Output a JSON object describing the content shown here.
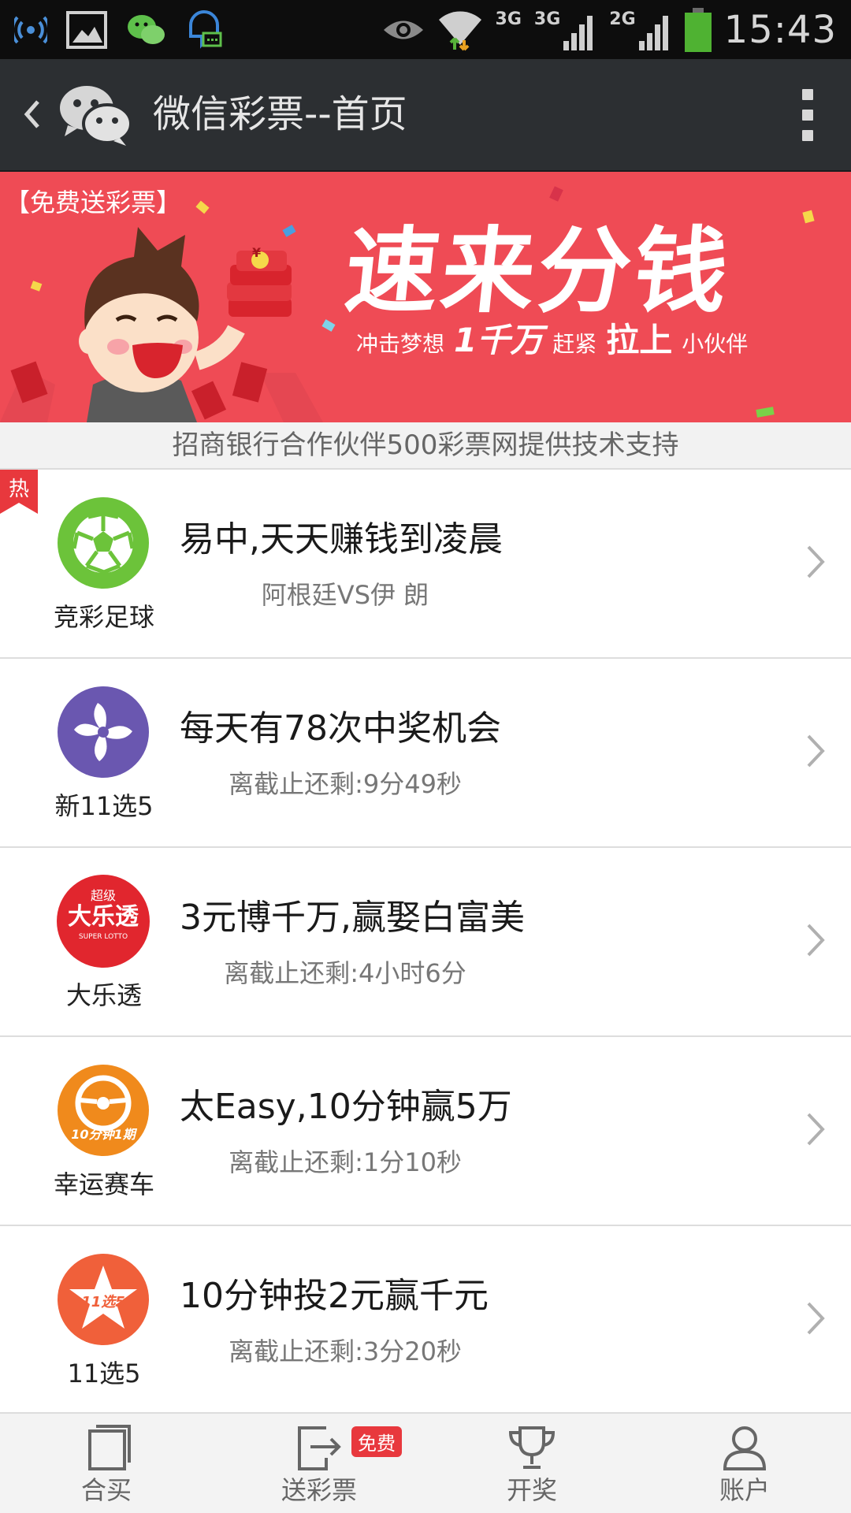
{
  "status_bar": {
    "network_3g_a": "3G",
    "network_3g_b": "3G",
    "network_2g": "2G",
    "time": "15:43",
    "icons": [
      "wifi-antenna-icon",
      "image-icon",
      "wechat-icon",
      "chat-bubble-icon",
      "eye-icon",
      "wifi-icon",
      "signal-icon",
      "battery-icon"
    ]
  },
  "header": {
    "title": "微信彩票--首页",
    "icons": [
      "back-icon",
      "wechat-logo-icon",
      "more-icon"
    ]
  },
  "banner": {
    "tag": "【免费送彩票】",
    "headline": "速来分钱",
    "sub_1": "冲击梦想",
    "sub_2": "1千万",
    "sub_3": "赶紧",
    "sub_4": "拉上",
    "sub_5": "小伙伴",
    "coin_symbol": "¥"
  },
  "sponsor": {
    "text": "招商银行合作伙伴500彩票网提供技术支持"
  },
  "lottery_items": [
    {
      "hot": "热",
      "name": "竞彩足球",
      "headline": "易中,天天赚钱到凌晨",
      "sub": "阿根廷VS伊 朗",
      "icon": "soccer-ball-icon",
      "color": "#6cc33a"
    },
    {
      "name": "新11选5",
      "headline": "每天有78次中奖机会",
      "sub": "离截止还剩:9分49秒",
      "icon": "pinwheel-icon",
      "color": "#6a57b0"
    },
    {
      "name": "大乐透",
      "headline": "3元博千万,赢娶白富美",
      "sub": "离截止还剩:4小时6分",
      "icon": "super-lotto-icon",
      "color": "#e1262e",
      "icon_text_top": "超级",
      "icon_text_main": "大乐透",
      "icon_text_bottom": "SUPER LOTTO"
    },
    {
      "name": "幸运赛车",
      "headline": "太Easy,10分钟赢5万",
      "sub": "离截止还剩:1分10秒",
      "icon": "steering-wheel-icon",
      "color": "#f08a1c",
      "icon_text": "10分钟1期"
    },
    {
      "name": "11选5",
      "headline": "10分钟投2元赢千元",
      "sub": "离截止还剩:3分20秒",
      "icon": "star-icon",
      "color": "#f0603a",
      "icon_text": "11选5"
    }
  ],
  "tab_bar": {
    "tabs": [
      {
        "label": "合买",
        "icon": "group-buy-icon"
      },
      {
        "label": "送彩票",
        "icon": "send-icon",
        "badge": "免费"
      },
      {
        "label": "开奖",
        "icon": "trophy-icon"
      },
      {
        "label": "账户",
        "icon": "user-icon"
      }
    ]
  },
  "colors": {
    "status_bar_bg": "#0d0d0d",
    "header_bg": "#2c2f32",
    "banner_bg": "#ef4b55",
    "hot_red": "#e8383d",
    "tab_bar_bg": "#f3f3f3"
  }
}
